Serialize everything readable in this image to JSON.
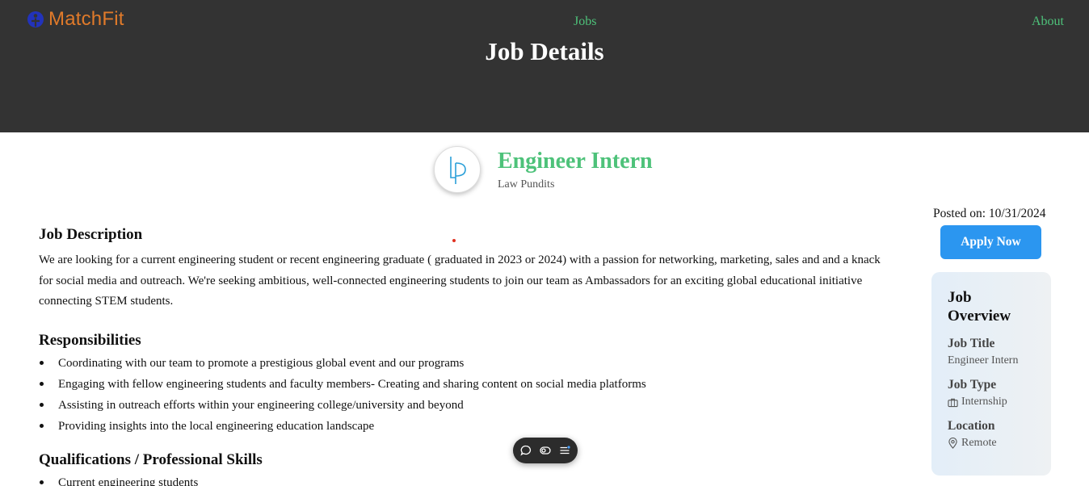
{
  "app": {
    "brand": "MatchFit",
    "nav": {
      "jobs": "Jobs",
      "about": "About"
    },
    "page_title": "Job Details",
    "colors": {
      "header_bg": "#333333",
      "brand_orange": "#e07a2a",
      "accent_green": "#4ec27a",
      "apply_blue": "#2b96f0"
    }
  },
  "job": {
    "title": "Engineer Intern",
    "company": "Law Pundits",
    "posted_label": "Posted on: 10/31/2024",
    "apply_label": "Apply Now",
    "description_heading": "Job Description",
    "description": "We are looking for a current engineering student or recent engineering graduate ( graduated in 2023 or 2024) with a passion for networking, marketing, sales and and a knack for social media and outreach. We're seeking ambitious, well-connected engineering students to join our team as Ambassadors for an exciting global educational initiative connecting STEM students.",
    "responsibilities_heading": "Responsibilities",
    "responsibilities": [
      "Coordinating with our team to promote a prestigious global event and our programs",
      "Engaging with fellow engineering students and faculty members- Creating and sharing content on social media platforms",
      "Assisting in outreach efforts within your engineering college/university and beyond",
      "Providing insights into the local engineering education landscape"
    ],
    "qualifications_heading": "Qualifications / Professional Skills",
    "qualifications": [
      "Current engineering students"
    ]
  },
  "overview": {
    "heading": "Job Overview",
    "title_label": "Job Title",
    "title_value": "Engineer Intern",
    "type_label": "Job Type",
    "type_value": "Internship",
    "location_label": "Location",
    "location_value": "Remote"
  },
  "icons": {
    "logo": "matchfit-logo-icon",
    "company_logo": "law-pundits-logo",
    "briefcase": "briefcase-icon",
    "location": "map-pin-icon",
    "toolbar": [
      "chat-bubble-icon",
      "toggle-icon",
      "menu-lines-icon"
    ]
  }
}
